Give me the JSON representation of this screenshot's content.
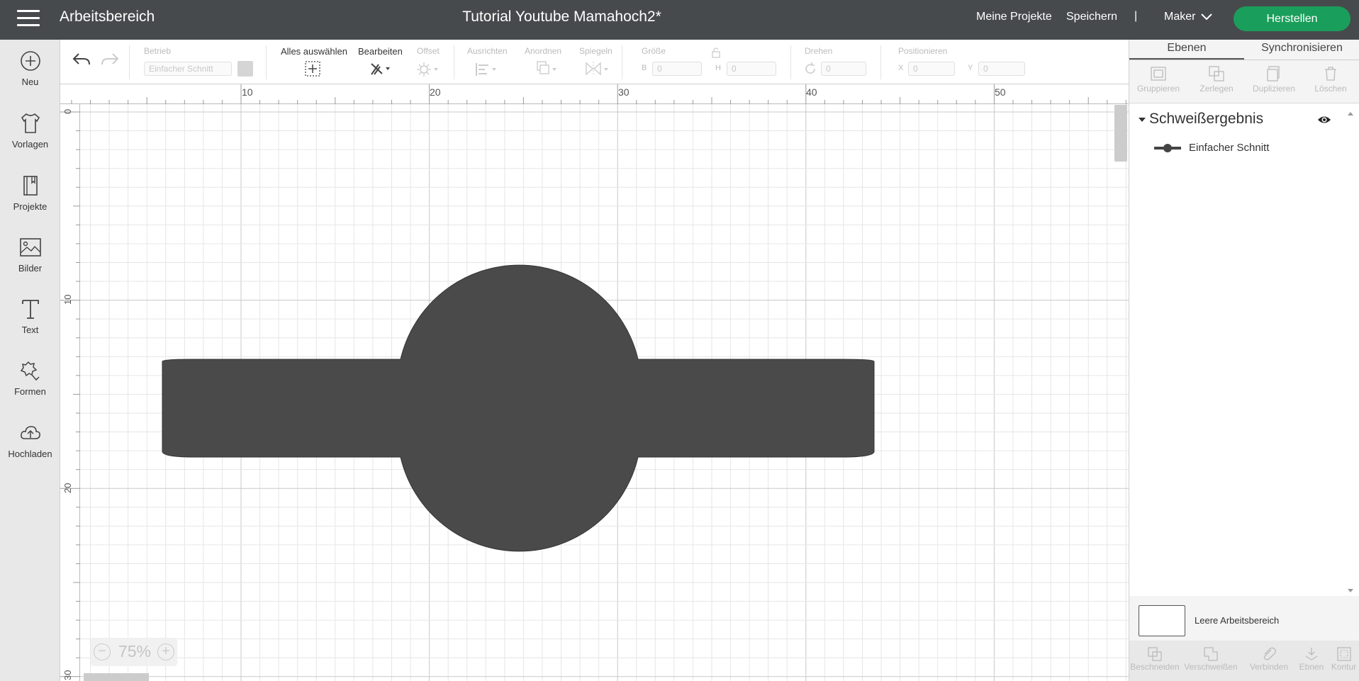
{
  "topbar": {
    "app_title": "Arbeitsbereich",
    "doc_title": "Tutorial Youtube Mamahoch2*",
    "my_projects": "Meine Projekte",
    "save": "Speichern",
    "separator": "|",
    "machine": "Maker",
    "make": "Herstellen",
    "make_color": "#1a9e5b"
  },
  "sidebar": {
    "items": [
      {
        "label": "Neu",
        "icon": "plus-circle-icon"
      },
      {
        "label": "Vorlagen",
        "icon": "tshirt-icon"
      },
      {
        "label": "Projekte",
        "icon": "notebook-icon"
      },
      {
        "label": "Bilder",
        "icon": "image-icon"
      },
      {
        "label": "Text",
        "icon": "text-icon"
      },
      {
        "label": "Formen",
        "icon": "shapes-icon"
      },
      {
        "label": "Hochladen",
        "icon": "cloud-upload-icon"
      }
    ]
  },
  "toolbar": {
    "operation_label": "Betrieb",
    "operation_value": "Einfacher Schnitt",
    "select_all": "Alles auswählen",
    "edit": "Bearbeiten",
    "offset": "Offset",
    "align": "Ausrichten",
    "arrange": "Anordnen",
    "flip": "Spiegeln",
    "size": "Größe",
    "size_w_label": "B",
    "size_w": "0",
    "size_h_label": "H",
    "size_h": "0",
    "rotate": "Drehen",
    "rotate_value": "0",
    "position": "Positionieren",
    "pos_x_label": "X",
    "pos_x": "0",
    "pos_y_label": "Y",
    "pos_y": "0"
  },
  "rulers": {
    "top": [
      "10",
      "20",
      "30",
      "40",
      "50"
    ],
    "left": [
      "0",
      "10",
      "20",
      "30"
    ]
  },
  "zoom": {
    "value": "75%",
    "minus": "−",
    "plus": "+"
  },
  "right_panel": {
    "tabs": [
      "Ebenen",
      "Synchronisieren"
    ],
    "actions": [
      "Gruppieren",
      "Zerlegen",
      "Duplizieren",
      "Löschen"
    ],
    "layer_group": "Schweißergebnis",
    "layer_item": "Einfacher Schnitt",
    "canvas_label": "Leere Arbeitsbereich",
    "bottom_actions": [
      "Beschneiden",
      "Verschweißen",
      "Verbinden",
      "Ebnen",
      "Kontur"
    ]
  },
  "shape_color": "#4a4a4a"
}
